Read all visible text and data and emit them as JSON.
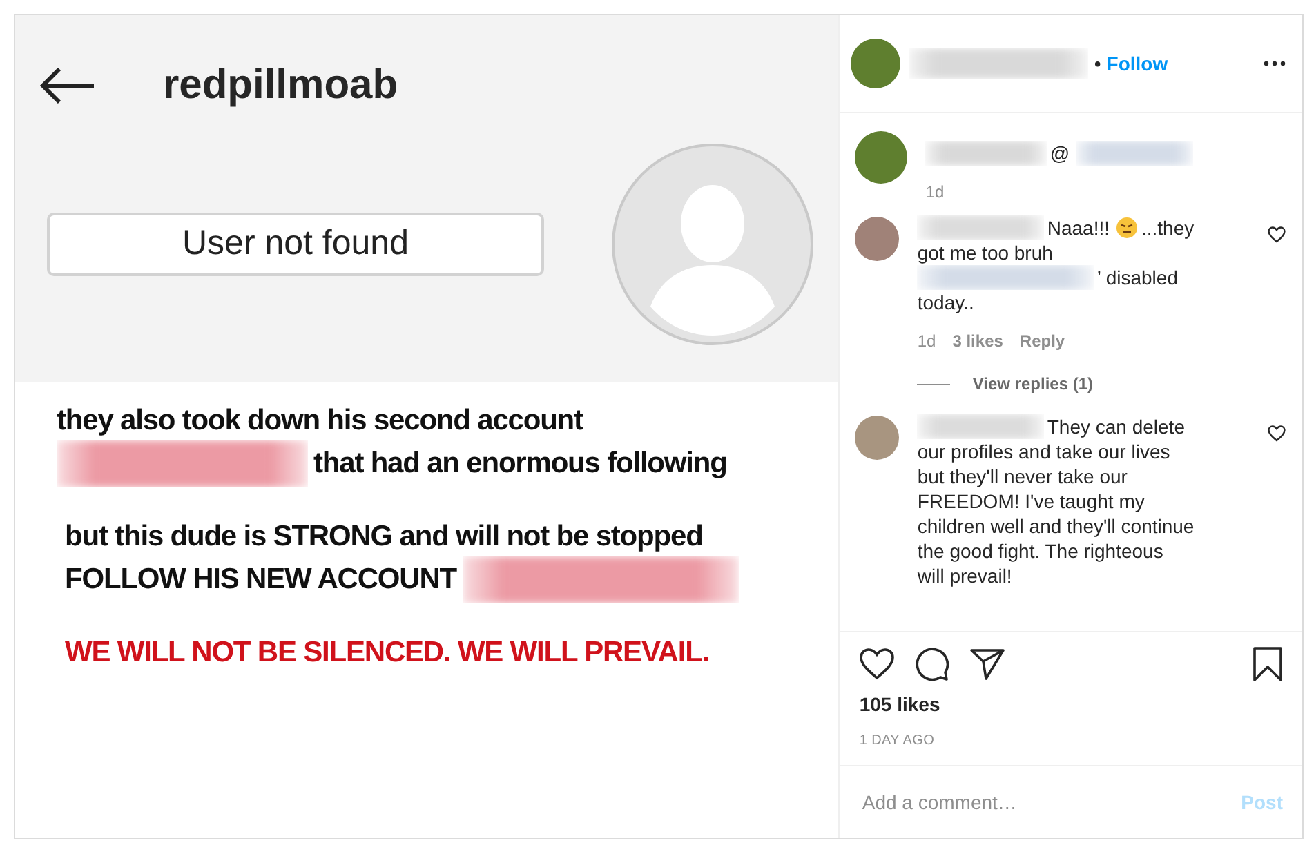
{
  "post_image": {
    "profile_title": "redpillmoab",
    "status_box": "User not found",
    "lines": [
      {
        "color": "#111111",
        "gap": false,
        "parts": [
          {
            "kind": "text",
            "text": "they also took down his second account"
          }
        ]
      },
      {
        "color": "#111111",
        "gap": false,
        "parts": [
          {
            "kind": "redaction",
            "color": "#ec9aa4"
          },
          {
            "kind": "text",
            "text": "that had an enormous following"
          }
        ]
      },
      {
        "color": "#111111",
        "gap": true,
        "parts": [
          {
            "kind": "text",
            "text": "but this dude is STRONG and will not be stopped"
          }
        ]
      },
      {
        "color": "#111111",
        "gap": false,
        "parts": [
          {
            "kind": "text",
            "text": "FOLLOW HIS NEW ACCOUNT"
          },
          {
            "kind": "redaction",
            "color": "#ec9aa4"
          }
        ]
      },
      {
        "color": "#d0121b",
        "gap": true,
        "parts": [
          {
            "kind": "text",
            "text": "WE WILL NOT BE SILENCED. WE WILL PREVAIL."
          }
        ]
      }
    ]
  },
  "post_header": {
    "username": {
      "kind": "redaction",
      "color": "#d9d9d9"
    },
    "separator": "•",
    "follow": "Follow"
  },
  "caption": {
    "parts": [
      {
        "kind": "redaction",
        "color": "#d9d9d9"
      },
      {
        "kind": "text",
        "text": "@"
      },
      {
        "kind": "redaction",
        "color": "#d4dce8"
      }
    ],
    "time": "1d"
  },
  "comments": [
    {
      "liked": false,
      "parts": [
        {
          "kind": "redaction",
          "color": "#dcdcdc"
        },
        {
          "kind": "text",
          "text": "Naaa!!!"
        },
        {
          "kind": "emoji"
        },
        {
          "kind": "text",
          "text": "...they"
        },
        {
          "kind": "text",
          "text": "got me too bruh"
        },
        {
          "kind": "redaction",
          "color": "#d4dce8"
        },
        {
          "kind": "text",
          "text": "’ disabled"
        },
        {
          "kind": "text",
          "text": "today.."
        }
      ],
      "time": "1d",
      "likes": "3 likes",
      "reply": "Reply",
      "view_replies": "View replies (1)"
    },
    {
      "liked": false,
      "parts": [
        {
          "kind": "redaction",
          "color": "#dcdcdc"
        },
        {
          "kind": "text",
          "text": "They can delete"
        },
        {
          "kind": "text",
          "text": "our profiles and take our lives but they'll never take our FREEDOM! I've taught my children well and they'll continue the good fight. The righteous will prevail!"
        }
      ]
    }
  ],
  "likes": "105 likes",
  "date": "1 DAY AGO",
  "comment_field": {
    "placeholder": "Add a comment…",
    "button": "Post",
    "button_disabled": true
  }
}
